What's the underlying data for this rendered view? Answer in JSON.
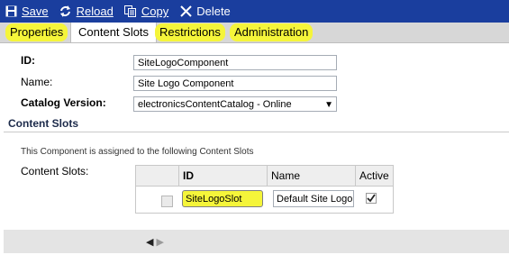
{
  "toolbar": {
    "save": {
      "label": "Save",
      "icon": "floppy-disk-icon"
    },
    "reload": {
      "label": "Reload",
      "icon": "refresh-icon"
    },
    "copy": {
      "label": "Copy",
      "icon": "copy-icon"
    },
    "delete": {
      "label": "Delete",
      "icon": "close-icon"
    }
  },
  "tabs": [
    {
      "label": "Properties",
      "state": "highlighted"
    },
    {
      "label": "Content Slots",
      "state": "active"
    },
    {
      "label": "Restrictions",
      "state": "highlighted"
    },
    {
      "label": "Administration",
      "state": "highlighted"
    }
  ],
  "form": {
    "id_label": "ID:",
    "id_value": "SiteLogoComponent",
    "name_label": "Name:",
    "name_value": "Site Logo Component",
    "catalog_label": "Catalog Version:",
    "catalog_value": "electronicsContentCatalog - Online"
  },
  "section": {
    "title": "Content Slots",
    "info": "This Component is assigned to the following Content Slots",
    "slots_label": "Content Slots:"
  },
  "table": {
    "headers": [
      "",
      "ID",
      "Name",
      "Active"
    ],
    "rows": [
      {
        "id": "SiteLogoSlot",
        "name": "Default Site Logo",
        "active": true
      }
    ]
  },
  "pager": {
    "prev": "◀",
    "next": "▶"
  },
  "colors": {
    "toolbar": "#1a3e9e",
    "highlight": "#f5f53a",
    "tabs_bg": "#d7d7d7"
  }
}
